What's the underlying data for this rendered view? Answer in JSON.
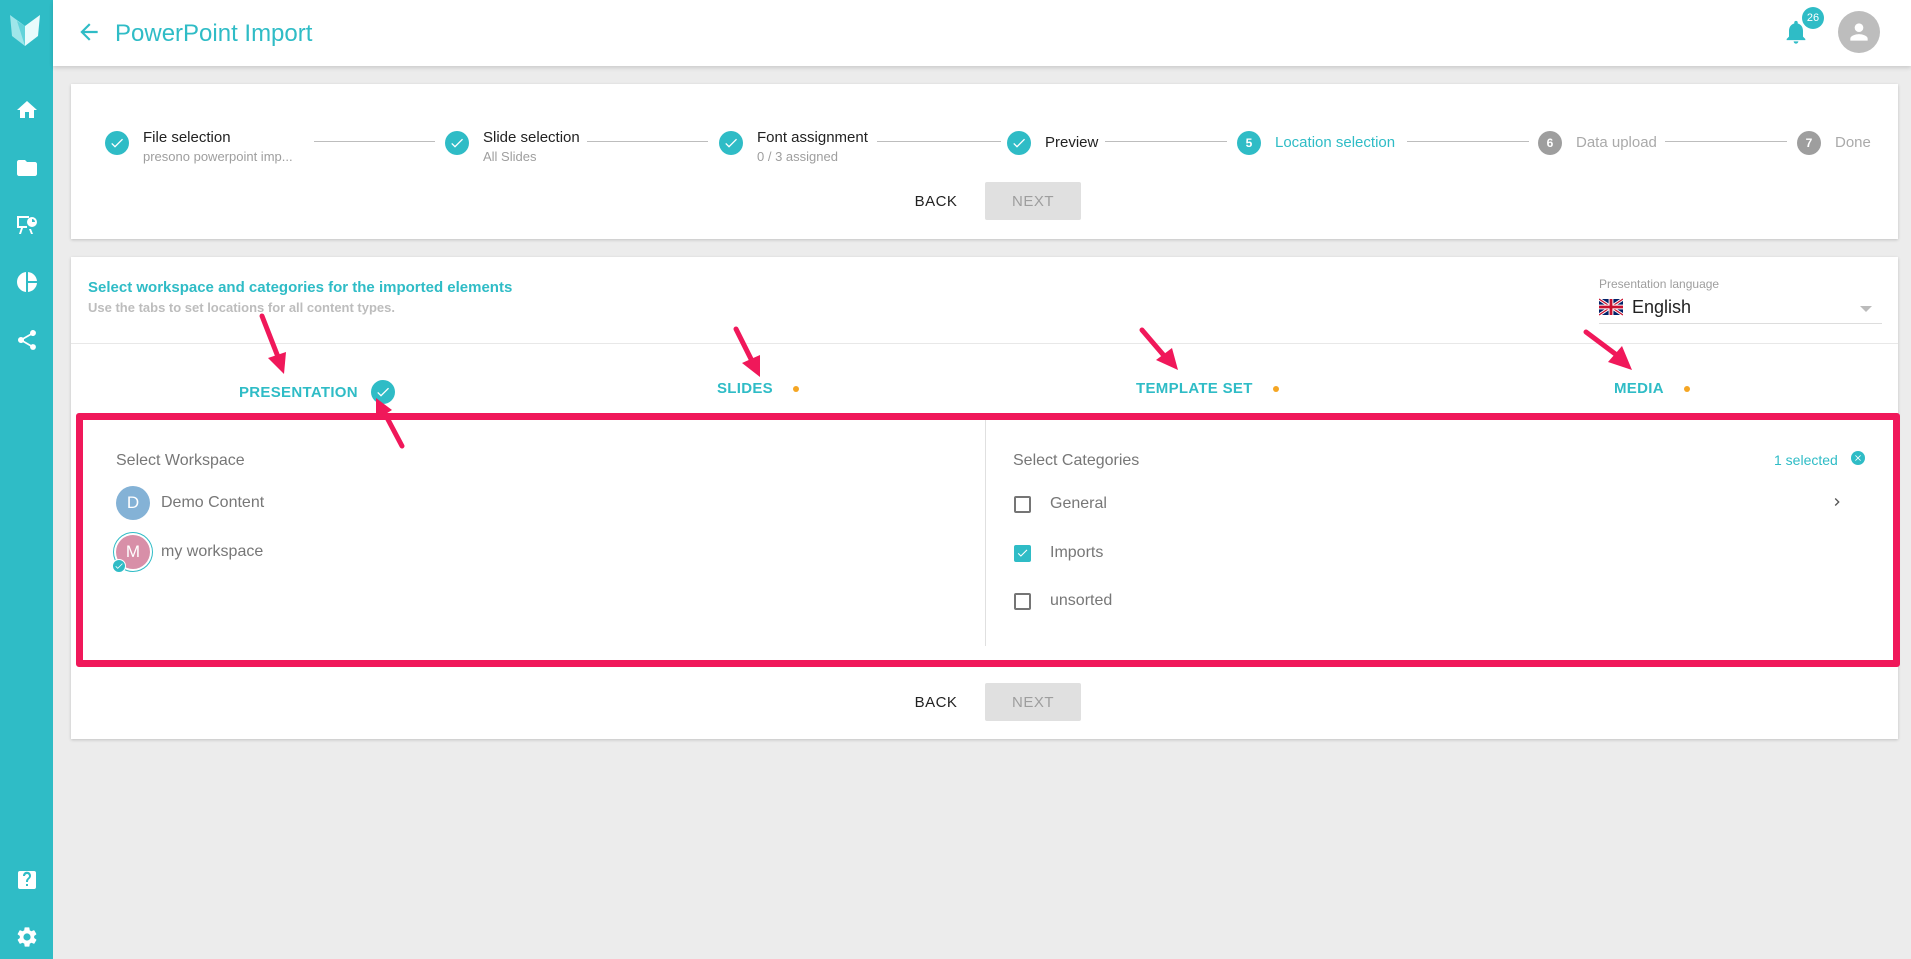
{
  "app": {
    "title": "PowerPoint Import",
    "notification_count": "26",
    "colors": {
      "accent": "#2fbcc6",
      "highlight": "#f0185a",
      "pending_dot": "#f5a623"
    }
  },
  "sidebar": {
    "items": [
      {
        "icon": "home-icon"
      },
      {
        "icon": "folder-icon"
      },
      {
        "icon": "presentation-icon"
      },
      {
        "icon": "pie-chart-icon"
      },
      {
        "icon": "share-icon"
      },
      {
        "icon": "help-icon"
      },
      {
        "icon": "gear-icon"
      }
    ]
  },
  "stepper": {
    "steps": [
      {
        "label": "File selection",
        "sub": "presono powerpoint imp...",
        "state": "done"
      },
      {
        "label": "Slide selection",
        "sub": "All Slides",
        "state": "done"
      },
      {
        "label": "Font assignment",
        "sub": "0 / 3 assigned",
        "state": "done"
      },
      {
        "label": "Preview",
        "sub": "",
        "state": "done"
      },
      {
        "label": "Location selection",
        "number": "5",
        "state": "active"
      },
      {
        "label": "Data upload",
        "number": "6",
        "state": "pending"
      },
      {
        "label": "Done",
        "number": "7",
        "state": "pending"
      }
    ],
    "back_label": "BACK",
    "next_label": "NEXT"
  },
  "location": {
    "title": "Select workspace and categories for the imported elements",
    "subtitle": "Use the tabs to set locations for all content types.",
    "language_label": "Presentation language",
    "language_value": "English",
    "tabs": [
      {
        "label": "PRESENTATION",
        "status": "complete"
      },
      {
        "label": "SLIDES",
        "status": "pending"
      },
      {
        "label": "TEMPLATE SET",
        "status": "pending"
      },
      {
        "label": "MEDIA",
        "status": "pending"
      }
    ],
    "workspace_label": "Select Workspace",
    "workspaces": [
      {
        "initial": "D",
        "name": "Demo Content",
        "selected": false
      },
      {
        "initial": "M",
        "name": "my workspace",
        "selected": true
      }
    ],
    "categories_label": "Select Categories",
    "selected_count": "1 selected",
    "categories": [
      {
        "name": "General",
        "checked": false,
        "has_children": true
      },
      {
        "name": "Imports",
        "checked": true,
        "has_children": false
      },
      {
        "name": "unsorted",
        "checked": false,
        "has_children": false
      }
    ],
    "back_label": "BACK",
    "next_label": "NEXT"
  }
}
